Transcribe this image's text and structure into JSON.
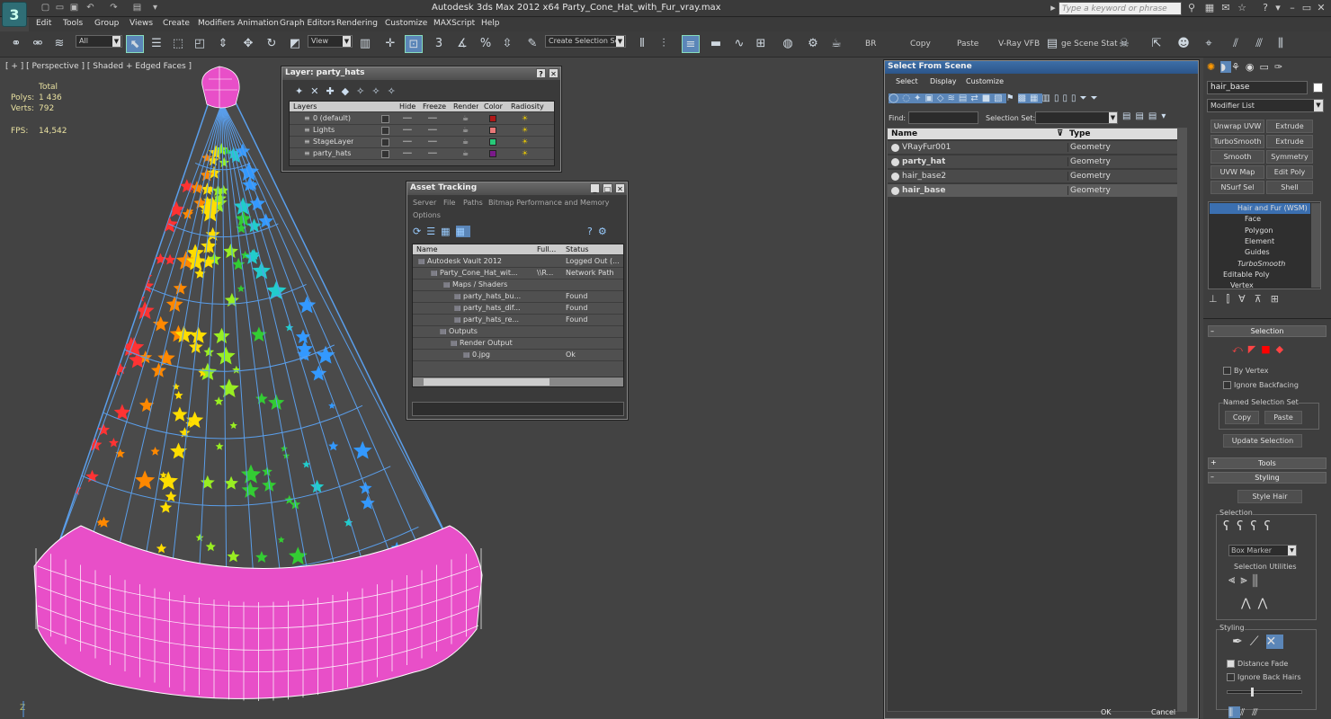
{
  "title_bar": {
    "title": "Autodesk 3ds Max  2012 x64      Party_Cone_Hat_with_Fur_vray.max",
    "search_placeholder": "Type a keyword or phrase"
  },
  "menu": [
    "Edit",
    "Tools",
    "Group",
    "Views",
    "Create",
    "Modifiers",
    "Animation",
    "Graph Editors",
    "Rendering",
    "Customize",
    "MAXScript",
    "Help"
  ],
  "toolbar": {
    "selection_filter": "All",
    "ref_coord": "View",
    "selection_set_placeholder": "Create Selection Se",
    "labels": [
      "BR",
      "Copy",
      "Paste",
      "V-Ray VFB",
      "ge Scene Stat"
    ],
    "snap_toggle": "3",
    "percent_snap": "%"
  },
  "viewport": {
    "label": "[ + ] [ Perspective ] [ Shaded + Edged Faces ]",
    "stats": {
      "header": "Total",
      "polys_label": "Polys:",
      "polys_value": "1 436",
      "verts_label": "Verts:",
      "verts_value": "792",
      "fps_label": "FPS:",
      "fps_value": "14,542"
    },
    "axis_label": "Z"
  },
  "layer_window": {
    "title": "Layer: party_hats",
    "columns": [
      "Layers",
      "Hide",
      "Freeze",
      "Render",
      "Color",
      "Radiosity"
    ],
    "rows": [
      {
        "name": "0 (default)",
        "color": "#b01818"
      },
      {
        "name": "Lights",
        "color": "#e87878"
      },
      {
        "name": "StageLayer",
        "color": "#28c878"
      },
      {
        "name": "party_hats",
        "color": "#7a1a8a"
      }
    ]
  },
  "asset_tracking": {
    "title": "Asset Tracking",
    "menu": [
      "Server",
      "File",
      "Paths",
      "Bitmap Performance and Memory",
      "Options"
    ],
    "columns": [
      "Name",
      "Full...",
      "Status"
    ],
    "rows": [
      {
        "name": "Autodesk Vault 2012",
        "full": "",
        "status": "Logged Out (..."
      },
      {
        "name": "Party_Cone_Hat_wit...",
        "full": "\\\\R...",
        "status": "Network Path"
      },
      {
        "name": "Maps / Shaders",
        "full": "",
        "status": ""
      },
      {
        "name": "party_hats_bu...",
        "full": "",
        "status": "Found"
      },
      {
        "name": "party_hats_dif...",
        "full": "",
        "status": "Found"
      },
      {
        "name": "party_hats_re...",
        "full": "",
        "status": "Found"
      },
      {
        "name": "Outputs",
        "full": "",
        "status": ""
      },
      {
        "name": "Render Output",
        "full": "",
        "status": ""
      },
      {
        "name": "0.jpg",
        "full": "",
        "status": "Ok"
      }
    ]
  },
  "select_from_scene": {
    "title": "Select From Scene",
    "menu": [
      "Select",
      "Display",
      "Customize"
    ],
    "find_label": "Find:",
    "selection_set_label": "Selection Set:",
    "columns": [
      "Name",
      "Type"
    ],
    "rows": [
      {
        "name": "VRayFur001",
        "type": "Geometry",
        "bold": false,
        "selected": false
      },
      {
        "name": "party_hat",
        "type": "Geometry",
        "bold": true,
        "selected": false
      },
      {
        "name": "hair_base2",
        "type": "Geometry",
        "bold": false,
        "selected": false
      },
      {
        "name": "hair_base",
        "type": "Geometry",
        "bold": true,
        "selected": true
      }
    ],
    "ok": "OK",
    "cancel": "Cancel"
  },
  "command_panel": {
    "object_name": "hair_base",
    "modifier_list": "Modifier List",
    "modifier_buttons": [
      "Unwrap UVW",
      "Extrude",
      "TurboSmooth",
      "Extrude",
      "Smooth",
      "Symmetry",
      "UVW Map",
      "Edit Poly",
      "NSurf Sel",
      "Shell"
    ],
    "stack": [
      "Hair and Fur (WSM)",
      "Face",
      "Polygon",
      "Element",
      "Guides",
      "TurboSmooth",
      "Editable Poly",
      "Vertex"
    ],
    "selection_rollout": "Selection",
    "by_vertex": "By Vertex",
    "ignore_backfacing": "Ignore Backfacing",
    "named_selection_set": "Named Selection Set",
    "copy": "Copy",
    "paste": "Paste",
    "update_selection": "Update Selection",
    "tools_rollout": "Tools",
    "styling_rollout": "Styling",
    "style_hair": "Style Hair",
    "selection_group": "Selection",
    "box_marker": "Box Marker",
    "selection_utilities": "Selection Utilities",
    "styling_group": "Styling",
    "distance_fade": "Distance Fade",
    "ignore_back_hairs": "Ignore Back Hairs"
  },
  "colors": {
    "pink": "#e84fc8",
    "cone": "#4a4a4a",
    "wire": "#5a9eea"
  }
}
